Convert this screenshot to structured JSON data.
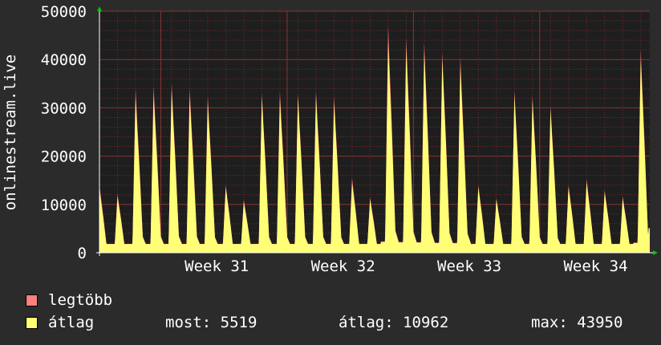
{
  "colors": {
    "background": "#2b2b2b",
    "plot_background": "#1e1e1e",
    "axis": "#ffffff",
    "minor_grid": "#6e2d2d",
    "major_grid": "#8a3333",
    "arrow": "#00cc00",
    "max_series": "#ff7f7f",
    "avg_series": "#ffff77"
  },
  "chart_data": {
    "type": "area",
    "ylabel": "onlinestream.live",
    "ylim": [
      0,
      50000
    ],
    "y_ticks": [
      0,
      10000,
      20000,
      30000,
      40000,
      50000
    ],
    "y_tick_labels": [
      "0",
      "10000",
      "20000",
      "30000",
      "40000",
      "50000"
    ],
    "x_labels": [
      "Week 31",
      "Week 32",
      "Week 33",
      "Week 34"
    ],
    "x_label_positions_days": [
      6.5,
      13.5,
      20.5,
      27.5
    ],
    "xlim_days": [
      0,
      30.5
    ],
    "grid": true,
    "legend_placement": "bottom-left",
    "daily_peaks": [
      {
        "day": 0.0,
        "avg": 13000,
        "max": 14000
      },
      {
        "day": 1.0,
        "avg": 11500,
        "max": 12200
      },
      {
        "day": 2.0,
        "avg": 32000,
        "max": 34000
      },
      {
        "day": 3.0,
        "avg": 32500,
        "max": 34500
      },
      {
        "day": 4.0,
        "avg": 33500,
        "max": 35000
      },
      {
        "day": 5.0,
        "avg": 32000,
        "max": 34000
      },
      {
        "day": 6.0,
        "avg": 31000,
        "max": 32500
      },
      {
        "day": 7.0,
        "avg": 13500,
        "max": 14000
      },
      {
        "day": 8.0,
        "avg": 10500,
        "max": 11000
      },
      {
        "day": 9.0,
        "avg": 32000,
        "max": 33000
      },
      {
        "day": 10.0,
        "avg": 32000,
        "max": 33300
      },
      {
        "day": 11.0,
        "avg": 32000,
        "max": 33000
      },
      {
        "day": 12.0,
        "avg": 32500,
        "max": 33500
      },
      {
        "day": 13.0,
        "avg": 31000,
        "max": 32500
      },
      {
        "day": 14.0,
        "avg": 14500,
        "max": 15500
      },
      {
        "day": 15.0,
        "avg": 11000,
        "max": 11500
      },
      {
        "day": 16.0,
        "avg": 43500,
        "max": 47000
      },
      {
        "day": 17.0,
        "avg": 42000,
        "max": 44500
      },
      {
        "day": 18.0,
        "avg": 41500,
        "max": 43500
      },
      {
        "day": 19.0,
        "avg": 40000,
        "max": 41500
      },
      {
        "day": 20.0,
        "avg": 38500,
        "max": 40500
      },
      {
        "day": 21.0,
        "avg": 13500,
        "max": 14000
      },
      {
        "day": 22.0,
        "avg": 11000,
        "max": 11300
      },
      {
        "day": 23.0,
        "avg": 32500,
        "max": 33500
      },
      {
        "day": 24.0,
        "avg": 31500,
        "max": 32500
      },
      {
        "day": 25.0,
        "avg": 29500,
        "max": 30500
      },
      {
        "day": 26.0,
        "avg": 13500,
        "max": 14000
      },
      {
        "day": 27.0,
        "avg": 14500,
        "max": 15300
      },
      {
        "day": 28.0,
        "avg": 12500,
        "max": 13000
      },
      {
        "day": 29.0,
        "avg": 11200,
        "max": 11700
      },
      {
        "day": 30.0,
        "avg": 40000,
        "max": 42000
      }
    ],
    "end_value": 5519,
    "series": [
      {
        "name": "legtöbb",
        "color": "#ff7f7f"
      },
      {
        "name": "átlag",
        "color": "#ffff77"
      }
    ]
  },
  "legend": {
    "max_label": "legtöbb",
    "avg_label": "átlag",
    "now_text": "most: 5519",
    "avg_text": "átlag: 10962",
    "max_text": "max: 43950"
  }
}
